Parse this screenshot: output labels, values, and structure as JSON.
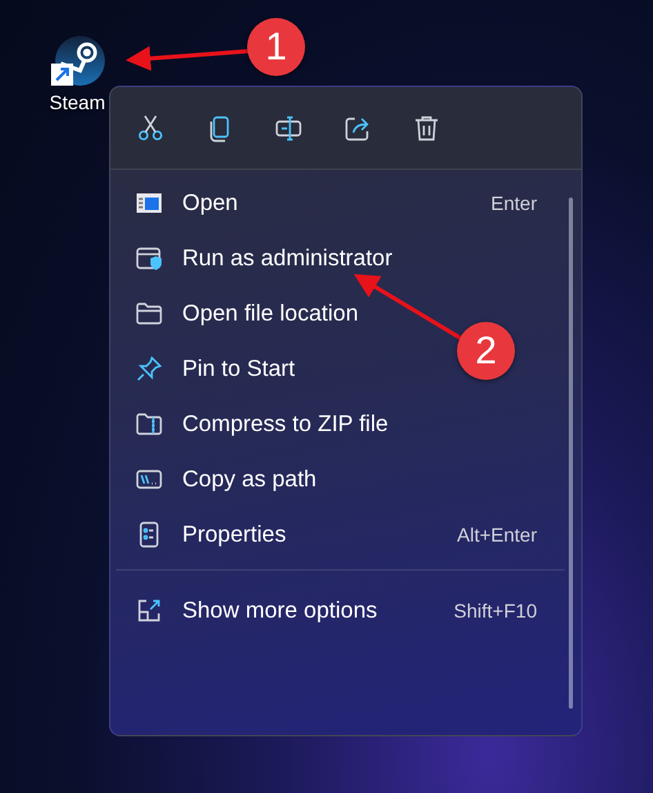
{
  "desktop_icon": {
    "label": "Steam"
  },
  "annotations": [
    {
      "number": "1"
    },
    {
      "number": "2"
    }
  ],
  "context_menu": {
    "toolbar": [
      {
        "kind": "cut"
      },
      {
        "kind": "copy"
      },
      {
        "kind": "rename"
      },
      {
        "kind": "share"
      },
      {
        "kind": "delete"
      }
    ],
    "items": [
      {
        "kind": "open",
        "label": "Open",
        "shortcut": "Enter"
      },
      {
        "kind": "admin",
        "label": "Run as administrator"
      },
      {
        "kind": "folder",
        "label": "Open file location"
      },
      {
        "kind": "pin",
        "label": "Pin to Start"
      },
      {
        "kind": "zip",
        "label": "Compress to ZIP file"
      },
      {
        "kind": "path",
        "label": "Copy as path"
      },
      {
        "kind": "properties",
        "label": "Properties",
        "shortcut": "Alt+Enter"
      }
    ],
    "footer_items": [
      {
        "kind": "more",
        "label": "Show more options",
        "shortcut": "Shift+F10"
      }
    ]
  }
}
